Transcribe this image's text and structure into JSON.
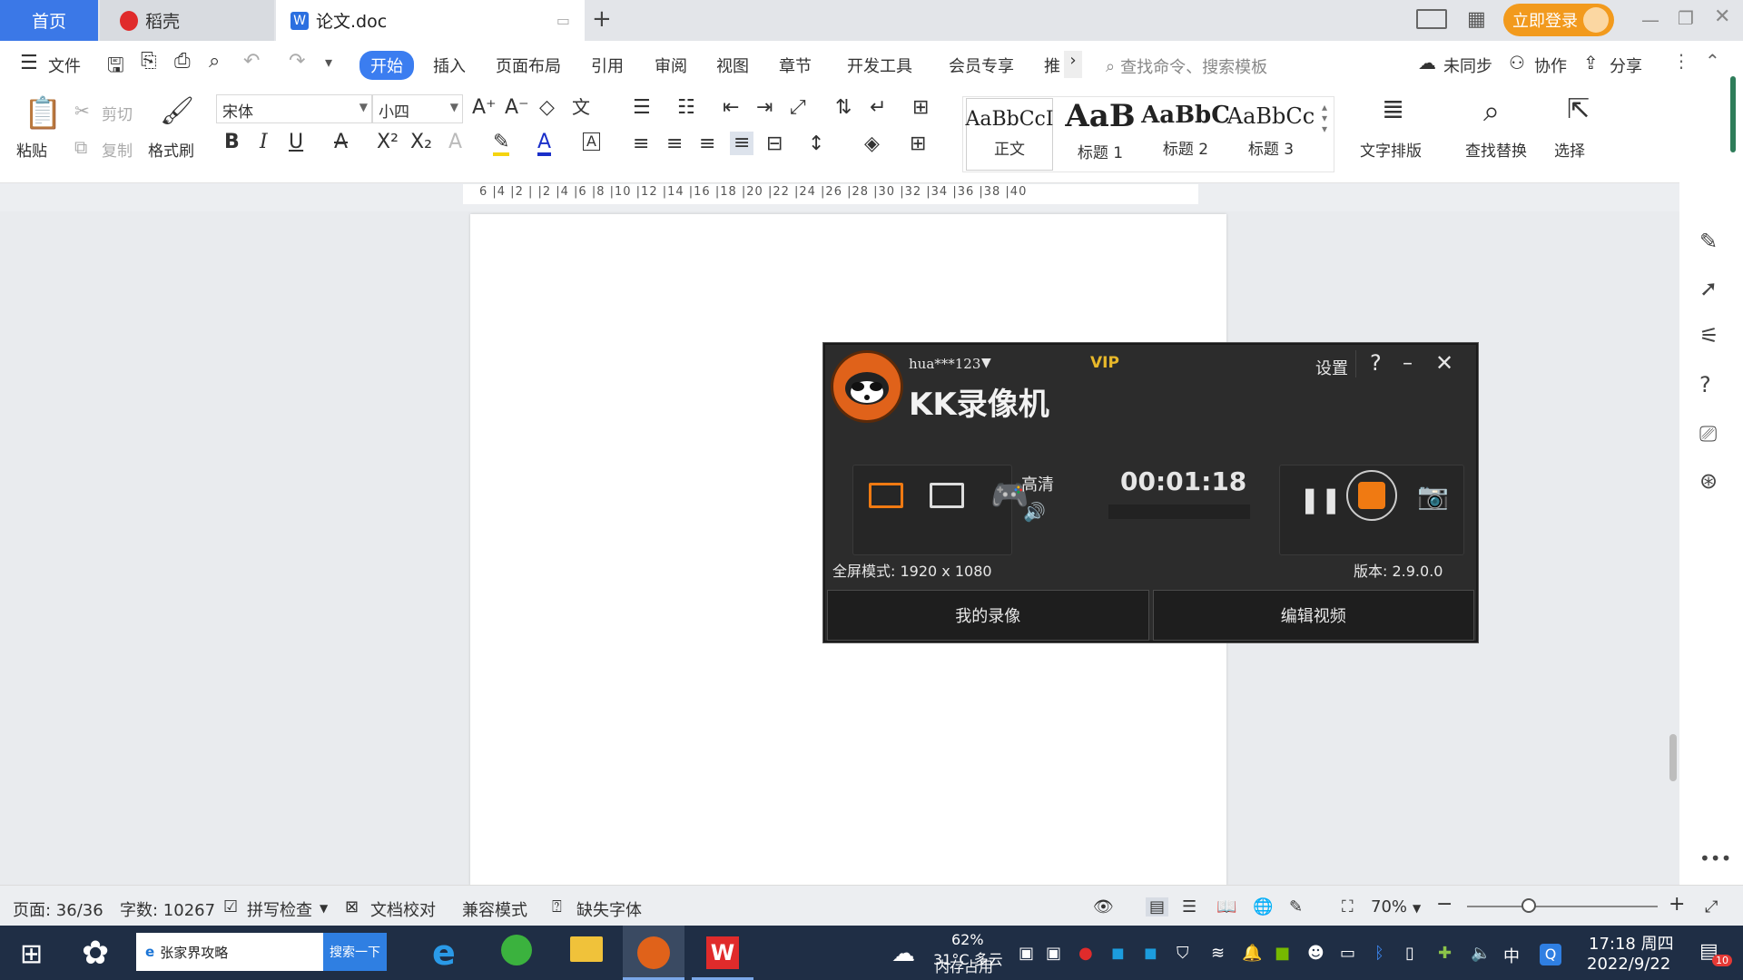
{
  "titlebar": {
    "tabs": [
      {
        "label": "首页"
      },
      {
        "label": "稻壳"
      },
      {
        "label": "论文.doc"
      }
    ],
    "new_tab": "+",
    "login": "立即登录"
  },
  "menu": {
    "file": "文件",
    "items": [
      "开始",
      "插入",
      "页面布局",
      "引用",
      "审阅",
      "视图",
      "章节",
      "开发工具",
      "会员专享",
      "推"
    ],
    "search_placeholder": "查找命令、搜索模板",
    "sync": "未同步",
    "collab": "协作",
    "share": "分享"
  },
  "toolbar": {
    "paste": "粘贴",
    "cut": "剪切",
    "copy": "复制",
    "format_painter": "格式刷",
    "font_name": "宋体",
    "font_size": "小四",
    "styles": [
      {
        "sample": "AaBbCcI",
        "name": "正文"
      },
      {
        "sample": "AaB",
        "name": "标题 1"
      },
      {
        "sample": "AaBbC",
        "name": "标题 2"
      },
      {
        "sample": "AaBbCc",
        "name": "标题 3"
      }
    ],
    "text_layout": "文字排版",
    "find_replace": "查找替换",
    "select": "选择"
  },
  "ruler": {
    "ticks": "6 |4 |2 | |2 |4 |6 |8 |10 |12 |14 |16 |18 |20 |22 |24 |26 |28 |30 |32 |34 |36 |38 |40"
  },
  "kk": {
    "user": "hua***123",
    "vip": "VIP",
    "settings": "设置",
    "help": "?",
    "title": "KK录像机",
    "quality": "高清",
    "timer": "00:01:18",
    "mode": "全屏模式: 1920 x 1080",
    "version": "版本: 2.9.0.0",
    "my_recordings": "我的录像",
    "edit_video": "编辑视频",
    "accent_color": "#f07a12"
  },
  "status": {
    "page": "页面: 36/36",
    "words": "字数: 10267",
    "spell": "拼写检查",
    "proof": "文档校对",
    "compat": "兼容模式",
    "missing_font": "缺失字体",
    "zoom": "70%"
  },
  "taskbar": {
    "search_text": "张家界攻略",
    "search_btn": "搜索一下",
    "weather_temp": "31°C 多云",
    "memory_pct": "62%",
    "memory_label": "内存占用",
    "ime": "中",
    "time": "17:18 周四",
    "date": "2022/9/22",
    "notif_count": "10"
  }
}
